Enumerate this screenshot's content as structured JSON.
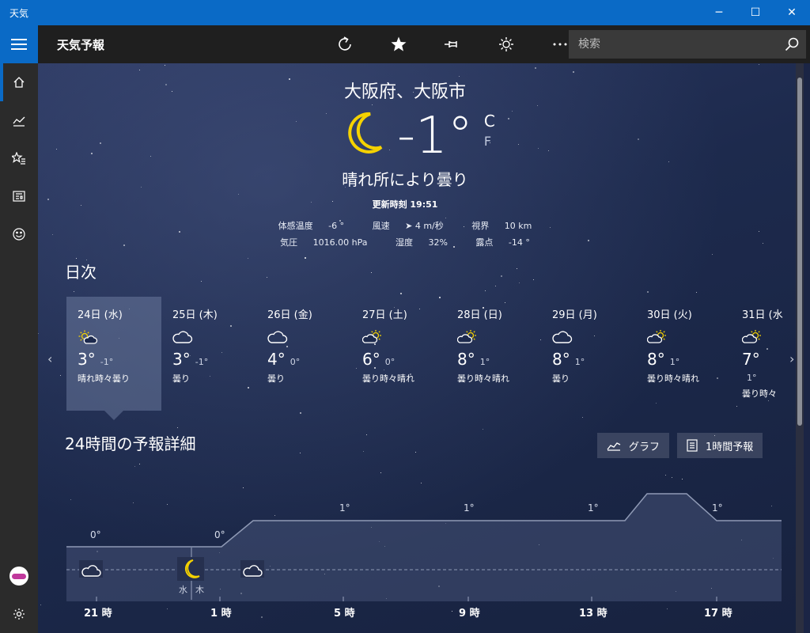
{
  "window": {
    "title": "天気"
  },
  "app": {
    "title": "天気予報"
  },
  "search": {
    "placeholder": "検索"
  },
  "current": {
    "location": "大阪府、大阪市",
    "temp": "-1°",
    "unit_c": "C",
    "unit_f": "F",
    "condition": "晴れ所により曇り",
    "updated": "更新時刻 19:51",
    "feels_like_label": "体感温度",
    "feels_like": "-6 °",
    "wind_label": "風速",
    "wind": "➤ 4 m/秒",
    "visibility_label": "視界",
    "visibility": "10 km",
    "pressure_label": "気圧",
    "pressure": "1016.00 hPa",
    "humidity_label": "湿度",
    "humidity": "32%",
    "dewpoint_label": "露点",
    "dewpoint": "-14 °"
  },
  "daily": {
    "title": "日次",
    "days": [
      {
        "date": "24日 (水)",
        "icon": "sun-cloud-icon",
        "hi": "3°",
        "lo": "-1°",
        "cond": "晴れ時々曇り"
      },
      {
        "date": "25日 (木)",
        "icon": "cloud-icon",
        "hi": "3°",
        "lo": "-1°",
        "cond": "曇り"
      },
      {
        "date": "26日 (金)",
        "icon": "cloud-icon",
        "hi": "4°",
        "lo": "0°",
        "cond": "曇り"
      },
      {
        "date": "27日 (土)",
        "icon": "cloud-sun-icon",
        "hi": "6°",
        "lo": "0°",
        "cond": "曇り時々晴れ"
      },
      {
        "date": "28日 (日)",
        "icon": "cloud-sun-icon",
        "hi": "8°",
        "lo": "1°",
        "cond": "曇り時々晴れ"
      },
      {
        "date": "29日 (月)",
        "icon": "cloud-icon",
        "hi": "8°",
        "lo": "1°",
        "cond": "曇り"
      },
      {
        "date": "30日 (火)",
        "icon": "cloud-sun-icon",
        "hi": "8°",
        "lo": "1°",
        "cond": "曇り時々晴れ"
      },
      {
        "date": "31日 (水",
        "icon": "cloud-sun-icon",
        "hi": "7°",
        "lo": "1°",
        "cond": "曇り時々"
      }
    ]
  },
  "hourly": {
    "title": "24時間の予報詳細",
    "graph_button": "グラフ",
    "hourly_button": "1時間予報",
    "day_left": "水",
    "day_right": "木",
    "temp_labels": [
      "0°",
      "0°",
      "1°",
      "1°",
      "1°",
      "1°"
    ],
    "time_labels": [
      "21 時",
      "1 時",
      "5 時",
      "9 時",
      "13 時",
      "17 時"
    ]
  },
  "colors": {
    "accent": "#0a6ac6",
    "moon": "#f5d200"
  }
}
